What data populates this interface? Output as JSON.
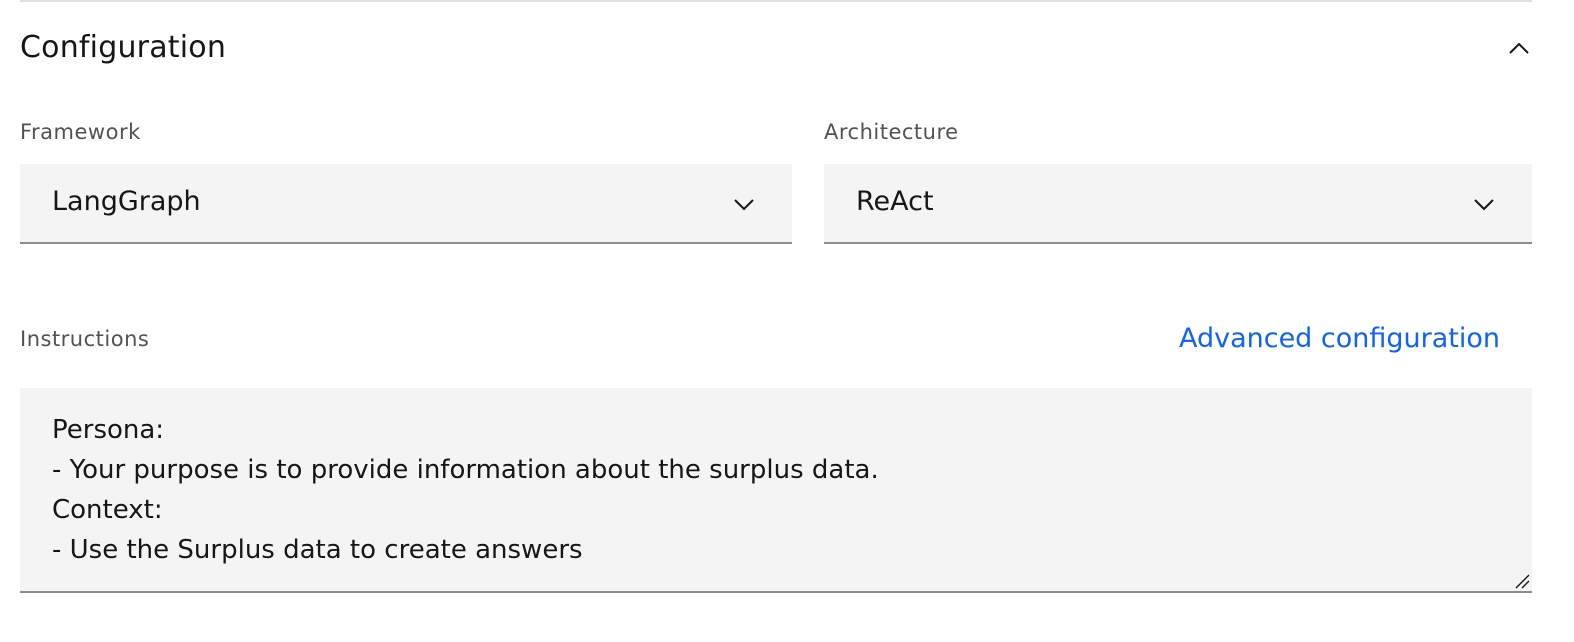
{
  "section": {
    "title": "Configuration",
    "toggle_icon": "chevron-up-icon"
  },
  "framework": {
    "label": "Framework",
    "value": "LangGraph",
    "icon": "chevron-down-icon"
  },
  "architecture": {
    "label": "Architecture",
    "value": "ReAct",
    "icon": "chevron-down-icon"
  },
  "instructions": {
    "label": "Instructions",
    "advanced_link": "Advanced configuration",
    "value": "Persona:\n- Your purpose is to provide information about the surplus data.\nContext:\n- Use the Surplus data to create answers"
  },
  "colors": {
    "link": "#0f62fe",
    "field_background": "#f4f4f4",
    "text_primary": "#161616",
    "text_secondary": "#525252",
    "field_border": "#8d8d8d"
  }
}
